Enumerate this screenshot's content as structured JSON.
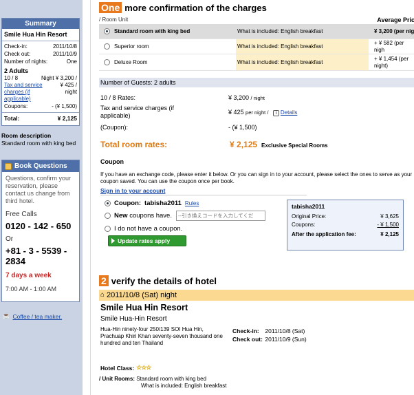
{
  "summary": {
    "title": "Summary",
    "hotel": "Smile Hua Hin Resort",
    "checkin_label": "Check-in:",
    "checkin": "2011/10/8",
    "checkout_label": "Check out:",
    "checkout": "2011/10/9",
    "nights_label": "Number of nights:",
    "nights": "One",
    "adults": "2 Adults",
    "date": "10 / 8",
    "night_price": "Night ¥ 3,200 /",
    "tax_label": "Tax and service charges (if applicable)",
    "tax_val": "¥ 425 / night",
    "coupons_label": "Coupons:",
    "coupons_val": "- (¥ 1,500)",
    "total_label": "Total:",
    "total_val": "¥ 2,125"
  },
  "room_desc": {
    "title": "Room description",
    "text": "Standard room with king bed"
  },
  "book": {
    "title": "Book Questions",
    "text": "Questions, confirm your reservation, please contact us change from third hotel.",
    "free_calls": "Free Calls",
    "phone1": "0120 - 142 - 650",
    "or": "Or",
    "phone2": "+81 - 3 - 5539 - 2834",
    "days": "7 days a week",
    "hours": "7:00 AM - 1:00 AM"
  },
  "coffee_link": "Coffee / tea maker.",
  "section1": {
    "badge": "One",
    "title": "more confirmation of the charges"
  },
  "rooms": {
    "col_unit": "/ Room Unit",
    "col_avg": "Average Pric",
    "items": [
      {
        "name": "Standard room with king bed",
        "included": "What is included: English breakfast",
        "price": "¥ 3,200 (per nig"
      },
      {
        "name": "Superior room",
        "included": "What is included: English breakfast",
        "price": "+ ¥ 582 (per nigh"
      },
      {
        "name": "Deluxe Room",
        "included": "What is included: English breakfast",
        "price": "+ ¥ 1,454 (per night)"
      }
    ]
  },
  "guests": "Number of Guests: 2 adults",
  "rates": {
    "date_label": "10 / 8 Rates:",
    "date_val": "¥ 3,200",
    "date_unit": "/ night",
    "tax_label": "Tax and service charges (if applicable)",
    "tax_val": "¥ 425",
    "tax_unit": "per night /",
    "details": "Details",
    "coupon_label": "(Coupon):",
    "coupon_val": "- (¥ 1,500)",
    "total_label": "Total room rates:",
    "total_val": "¥ 2,125",
    "total_note": "Exclusive Special Rooms"
  },
  "coupon": {
    "heading": "Coupon",
    "desc": "If you have an exchange code, please enter it below. Or you can sign in to your account, please select the ones to serve as your coupon saved. You can use the coupon once per book.",
    "signin": "Sign in to your account",
    "opt1_label": "Coupon:",
    "opt1_code": "tabisha2011",
    "opt1_rules": "Rules",
    "opt2_new": "New",
    "opt2_rest": "coupons have.",
    "input_placeholder": "--引き換えコードを入力してくだ",
    "opt3": "I do not have a coupon.",
    "apply": "Update rates apply"
  },
  "cbox": {
    "name": "tabisha2011",
    "orig_label": "Original Price:",
    "orig_val": "¥ 3,625",
    "coupons_label": "Coupons:",
    "coupons_val": "- ¥ 1,500",
    "after_label": "After the application fee:",
    "after_val": "¥ 2,125"
  },
  "section2": {
    "badge": "2",
    "title": "verify the details of hotel"
  },
  "hotel": {
    "date": "2011/10/8 (Sat) night",
    "name": "Smile Hua Hin Resort",
    "name2": "Smile Hua-Hin Resort",
    "address": "Hua-Hin ninety-four 250/139 SOI Hua Hin, Prachuap Khiri Khan seventy-seven thousand one hundred and ten Thailand",
    "checkin_label": "Check-in:",
    "checkin": "2011/10/8 (Sat)",
    "checkout_label": "Check out:",
    "checkout": "2011/10/9 (Sun)",
    "class_label": "Hotel Class:",
    "stars": "☆☆☆",
    "unit_label": "/ Unit Rooms:",
    "unit_room": "Standard room with king bed",
    "unit_included": "What is included: English breakfast"
  }
}
